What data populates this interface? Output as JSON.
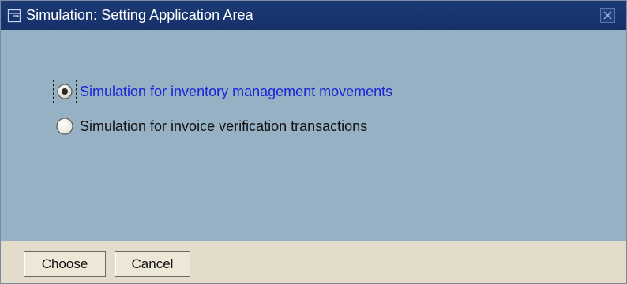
{
  "window": {
    "title": "Simulation: Setting Application Area",
    "title_icon": "dialog-icon",
    "close_icon": "close-icon"
  },
  "options": [
    {
      "label": "Simulation for inventory management movements",
      "selected": true
    },
    {
      "label": "Simulation for invoice verification transactions",
      "selected": false
    }
  ],
  "buttons": {
    "choose_label": "Choose",
    "cancel_label": "Cancel"
  },
  "colors": {
    "titlebar": "#1c3a75",
    "content_bg": "#96b0c4",
    "footer_bg": "#e3dccb",
    "selected_text": "#1a24d6"
  }
}
